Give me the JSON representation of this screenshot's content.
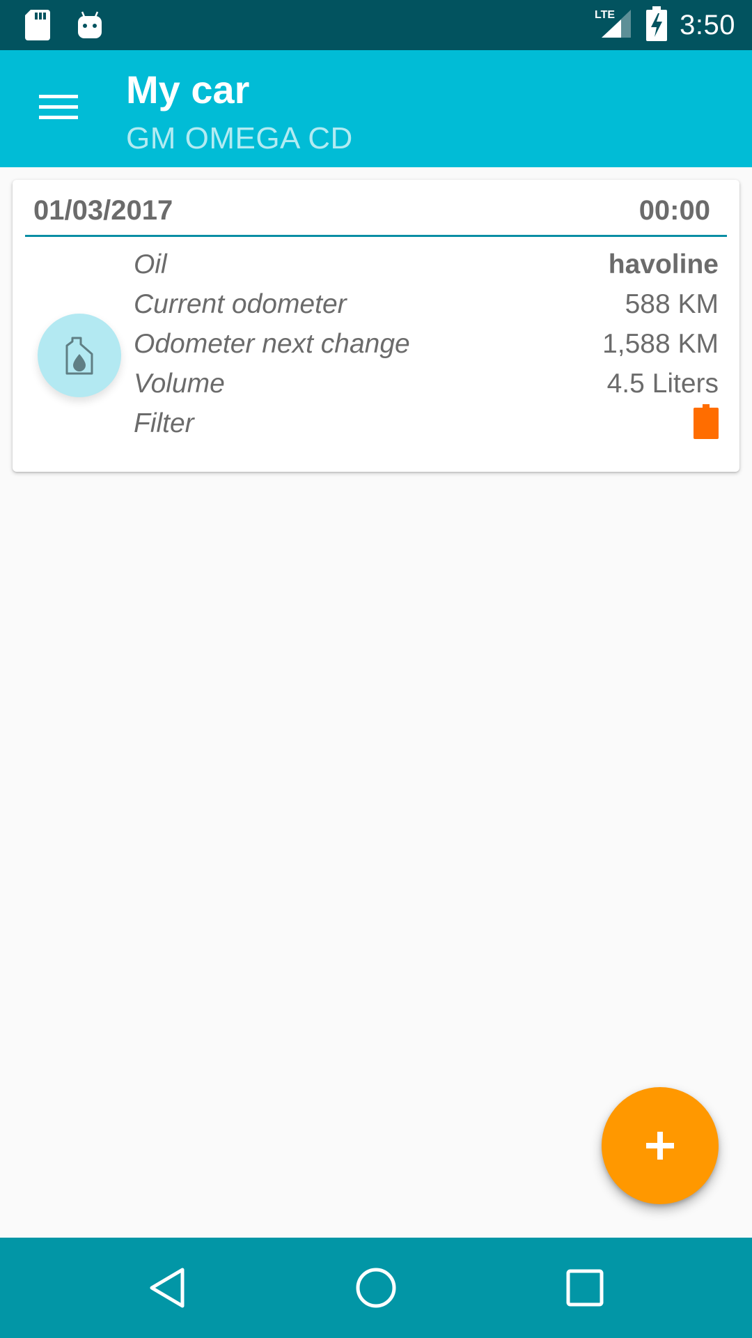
{
  "status_bar": {
    "time": "3:50",
    "network": "LTE",
    "icons": [
      "sd-card-icon",
      "android-icon",
      "signal-icon",
      "battery-charging-icon"
    ]
  },
  "app_bar": {
    "title": "My car",
    "subtitle": "GM OMEGA CD",
    "menu_icon": "hamburger-menu-icon",
    "color": "#01bcd6"
  },
  "card": {
    "date": "01/03/2017",
    "time": "00:00",
    "icon": "oil-can-icon",
    "rows": [
      {
        "label": "Oil",
        "value": "havoline"
      },
      {
        "label": "Current odometer",
        "value": "588 KM"
      },
      {
        "label": "Odometer next change",
        "value": "1,588 KM"
      },
      {
        "label": "Volume",
        "value": "4.5 Liters"
      },
      {
        "label": "Filter",
        "value": "",
        "indicator": "filter-icon",
        "indicator_color": "#ff6d00"
      }
    ]
  },
  "fab": {
    "icon": "plus-icon",
    "color": "#ff9800"
  },
  "nav_bar": {
    "buttons": [
      "back-icon",
      "home-icon",
      "recents-icon"
    ]
  }
}
